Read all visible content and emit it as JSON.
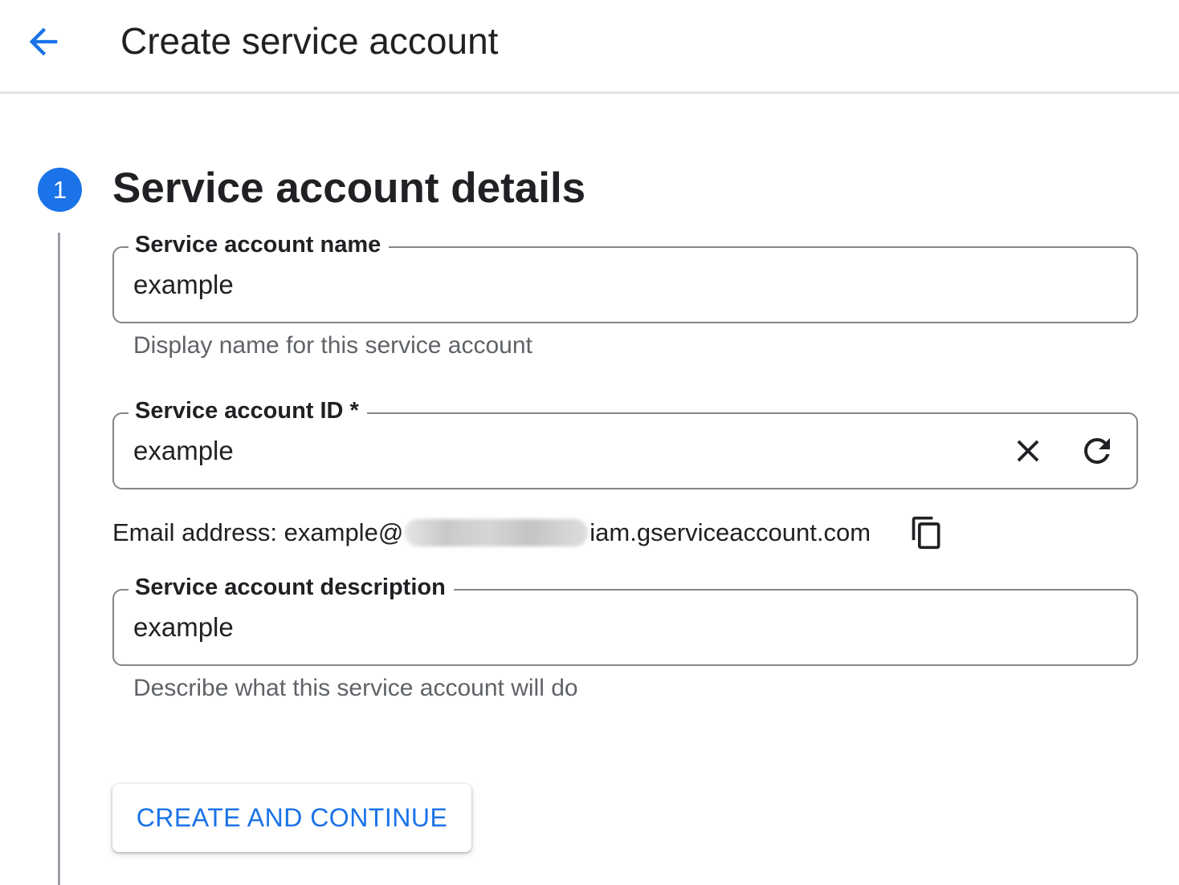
{
  "header": {
    "title": "Create service account",
    "back_icon": "arrow-back-icon"
  },
  "step": {
    "number": "1",
    "title": "Service account details"
  },
  "fields": {
    "name": {
      "label": "Service account name",
      "value": "example",
      "hint": "Display name for this service account"
    },
    "id": {
      "label": "Service account ID *",
      "value": "example",
      "clear_icon": "close-icon",
      "regenerate_icon": "refresh-icon"
    },
    "description": {
      "label": "Service account description",
      "value": "example",
      "hint": "Describe what this service account will do"
    }
  },
  "email": {
    "prefix": "Email address: example@",
    "suffix": "iam.gserviceaccount.com",
    "copy_icon": "copy-icon"
  },
  "actions": {
    "create_continue": "CREATE AND CONTINUE"
  },
  "colors": {
    "accent": "#1a73e8",
    "text_primary": "#202124",
    "text_secondary": "#5f6368",
    "outline": "#80868b",
    "divider": "#e3e4e6"
  }
}
